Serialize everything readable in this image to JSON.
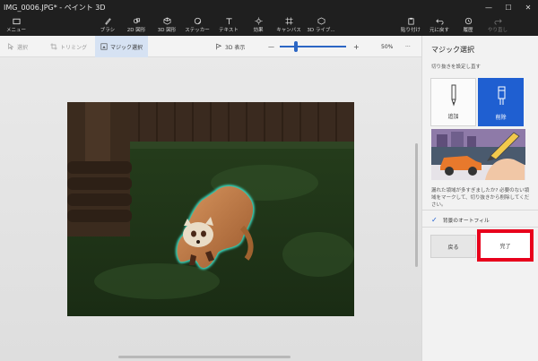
{
  "window": {
    "title": "IMG_0006.JPG* - ペイント 3D",
    "minimize": "—",
    "maximize": "☐",
    "close": "✕"
  },
  "ribbon": {
    "menu": "メニュー",
    "brush": "ブラシ",
    "shapes2d": "2D 図形",
    "shapes3d": "3D 図形",
    "sticker": "ステッカー",
    "text": "テキスト",
    "effects": "効果",
    "canvas": "キャンバス",
    "library3d": "3D ライブ...",
    "paste": "貼り付け",
    "undo": "元に戻す",
    "history": "履歴",
    "redo": "やり直し"
  },
  "subbar": {
    "select": "選択",
    "crop": "トリミング",
    "magic_select": "マジック選択",
    "view3d": "3D 表示",
    "zoom_minus": "—",
    "zoom_plus": "+",
    "zoom": "50%",
    "more": "···"
  },
  "panel": {
    "title": "マジック選択",
    "desc": "切り抜きを設定し直す",
    "add": "追加",
    "remove": "削除",
    "help": "漏れた領域が多すぎましたか? 必要のない領域をマークして、切り抜きから削除してください。",
    "autofill": "背景のオートフィル",
    "back": "戻る",
    "done": "完了"
  },
  "colors": {
    "accent": "#1f5fd1",
    "highlight": "#e8001c",
    "selection_glow": "#3cf0d8"
  }
}
